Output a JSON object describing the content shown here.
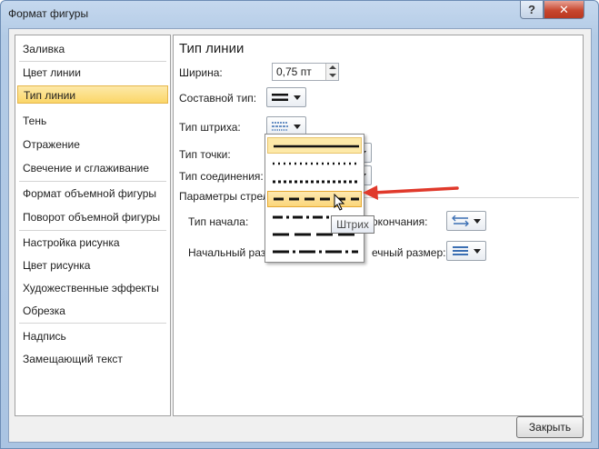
{
  "window": {
    "title": "Формат фигуры",
    "help_label": "?",
    "close_label": "✕"
  },
  "nav": {
    "items": [
      {
        "label": "Заливка"
      },
      {
        "label": "Цвет линии"
      },
      {
        "label": "Тип линии"
      },
      {
        "label": "Тень"
      },
      {
        "label": "Отражение"
      },
      {
        "label": "Свечение и сглаживание"
      },
      {
        "label": "Формат объемной фигуры"
      },
      {
        "label": "Поворот объемной фигуры"
      },
      {
        "label": "Настройка рисунка"
      },
      {
        "label": "Цвет рисунка"
      },
      {
        "label": "Художественные эффекты"
      },
      {
        "label": "Обрезка"
      },
      {
        "label": "Надпись"
      },
      {
        "label": "Замещающий текст"
      }
    ],
    "selected_index": 2
  },
  "panel": {
    "title": "Тип линии",
    "width_label": "Ширина:",
    "width_value": "0,75 пт",
    "compound_label": "Составной тип:",
    "dash_label": "Тип штриха:",
    "cap_label": "Тип точки:",
    "join_label": "Тип соединения:",
    "arrow_section_label": "Параметры стрел",
    "begin_type_label": "Тип начала:",
    "end_type_label": "окончания:",
    "begin_size_label": "Начальный разм",
    "end_size_label": "ечный размер:"
  },
  "dash_popup": {
    "options": [
      "solid",
      "round-dot",
      "square-dot",
      "dash",
      "dash-dot",
      "long-dash",
      "long-dash-dot"
    ],
    "hovered_index": 3,
    "current_index": 0,
    "tooltip": "Штрих"
  },
  "footer": {
    "close_label": "Закрыть"
  },
  "colors": {
    "accent_arrow": "#e0392b",
    "selection": "#fbd668"
  }
}
